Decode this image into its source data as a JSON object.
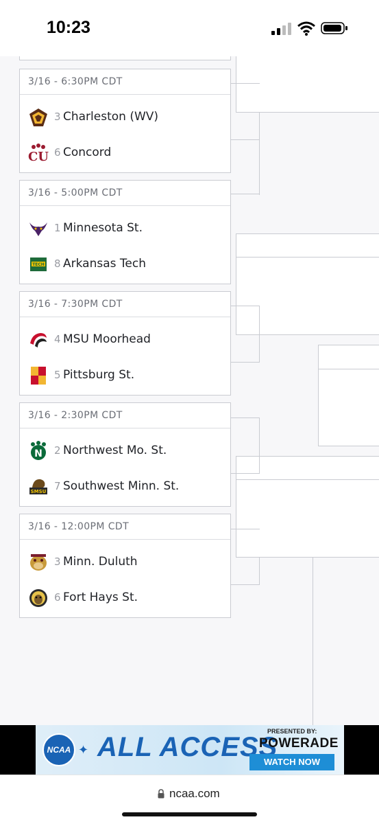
{
  "status_bar": {
    "time": "10:23"
  },
  "games": [
    {
      "header": "3/16  - 6:30PM CDT",
      "team1": {
        "seed": "3",
        "name": "Charleston (WV)",
        "logo": "charleston-logo"
      },
      "team2": {
        "seed": "6",
        "name": "Concord",
        "logo": "concord-logo"
      }
    },
    {
      "header": "3/16  - 5:00PM CDT",
      "team1": {
        "seed": "1",
        "name": "Minnesota St.",
        "logo": "minnesota-st-logo"
      },
      "team2": {
        "seed": "8",
        "name": "Arkansas Tech",
        "logo": "arkansas-tech-logo"
      }
    },
    {
      "header": "3/16  - 7:30PM CDT",
      "team1": {
        "seed": "4",
        "name": "MSU Moorhead",
        "logo": "msu-moorhead-logo"
      },
      "team2": {
        "seed": "5",
        "name": "Pittsburg St.",
        "logo": "pittsburg-st-logo"
      }
    },
    {
      "header": "3/16  - 2:30PM CDT",
      "team1": {
        "seed": "2",
        "name": "Northwest Mo. St.",
        "logo": "northwest-mo-st-logo"
      },
      "team2": {
        "seed": "7",
        "name": "Southwest Minn. St.",
        "logo": "southwest-minn-st-logo"
      }
    },
    {
      "header": "3/16  - 12:00PM CDT",
      "team1": {
        "seed": "3",
        "name": "Minn. Duluth",
        "logo": "minn-duluth-logo"
      },
      "team2": {
        "seed": "6",
        "name": "Fort Hays St.",
        "logo": "fort-hays-st-logo"
      }
    }
  ],
  "ad": {
    "logo_text": "NCAA",
    "title": "ALL ACCESS",
    "presented_by": "PRESENTED BY:",
    "sponsor": "POWERADE",
    "cta": "WATCH NOW"
  },
  "browser": {
    "url": "ncaa.com"
  }
}
